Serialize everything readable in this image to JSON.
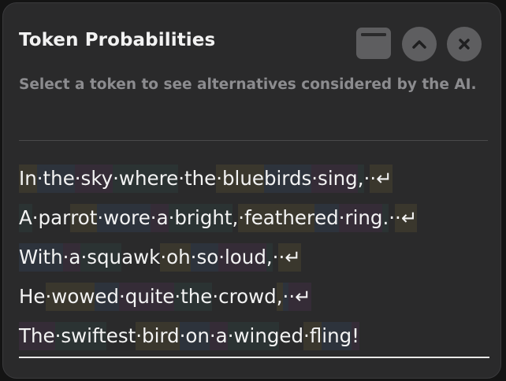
{
  "dialog": {
    "title": "Token Probabilities",
    "subtitle": "Select a token to see alternatives considered by the AI."
  },
  "controls": [
    {
      "name": "window-toggle-button",
      "icon": "window-icon"
    },
    {
      "name": "collapse-button",
      "icon": "chevron-up-icon"
    },
    {
      "name": "close-button",
      "icon": "close-icon"
    }
  ],
  "lines": [
    [
      "In",
      "·the",
      "·sky",
      "·where",
      "·the",
      "·blue",
      "birds",
      "·sing",
      ",",
      "·",
      "·↵"
    ],
    [
      "A",
      "·par",
      "rot",
      "·wore",
      "·a",
      "·bright",
      ",",
      "·feather",
      "ed",
      "·ring",
      ".",
      "·",
      "·↵"
    ],
    [
      "With",
      "·a",
      "·squ",
      "awk",
      "·oh",
      "·so",
      "·loud",
      ",",
      "·",
      "·↵"
    ],
    [
      "He",
      "·wow",
      "ed",
      "·quite",
      "·the",
      "·crowd",
      ",",
      "·",
      "·↵"
    ],
    [
      "The",
      "·swift",
      "est",
      "·bird",
      "·on",
      "·a",
      "·wing",
      "ed",
      "·fl",
      "ing",
      "!"
    ]
  ],
  "colors": {
    "panel": "#2a2a2b",
    "button": "#5e5e60",
    "text": "#f3f3f3",
    "muted": "#8c8c8f"
  }
}
